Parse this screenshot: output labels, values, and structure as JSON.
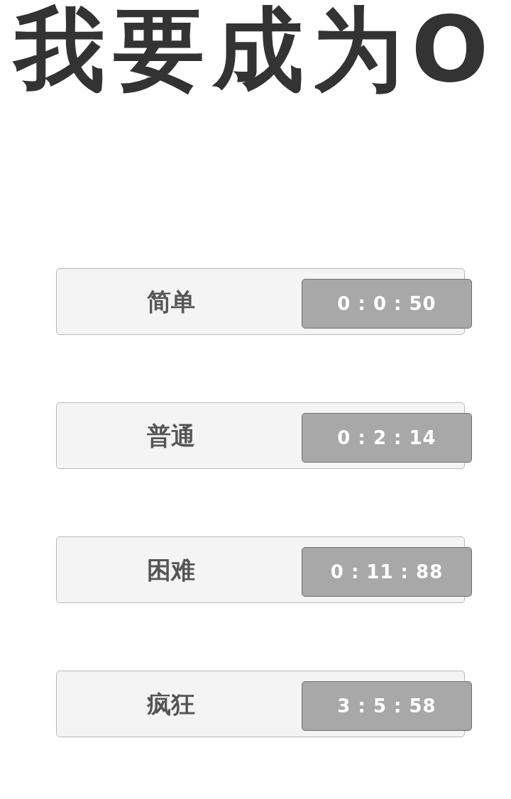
{
  "title": "我要成为O",
  "levels": [
    {
      "label": "简单",
      "best_time": "0 : 0 : 50"
    },
    {
      "label": "普通",
      "best_time": "0 : 2 : 14"
    },
    {
      "label": "困难",
      "best_time": "0 : 11 : 88"
    },
    {
      "label": "疯狂",
      "best_time": "3 : 5 : 58"
    }
  ]
}
